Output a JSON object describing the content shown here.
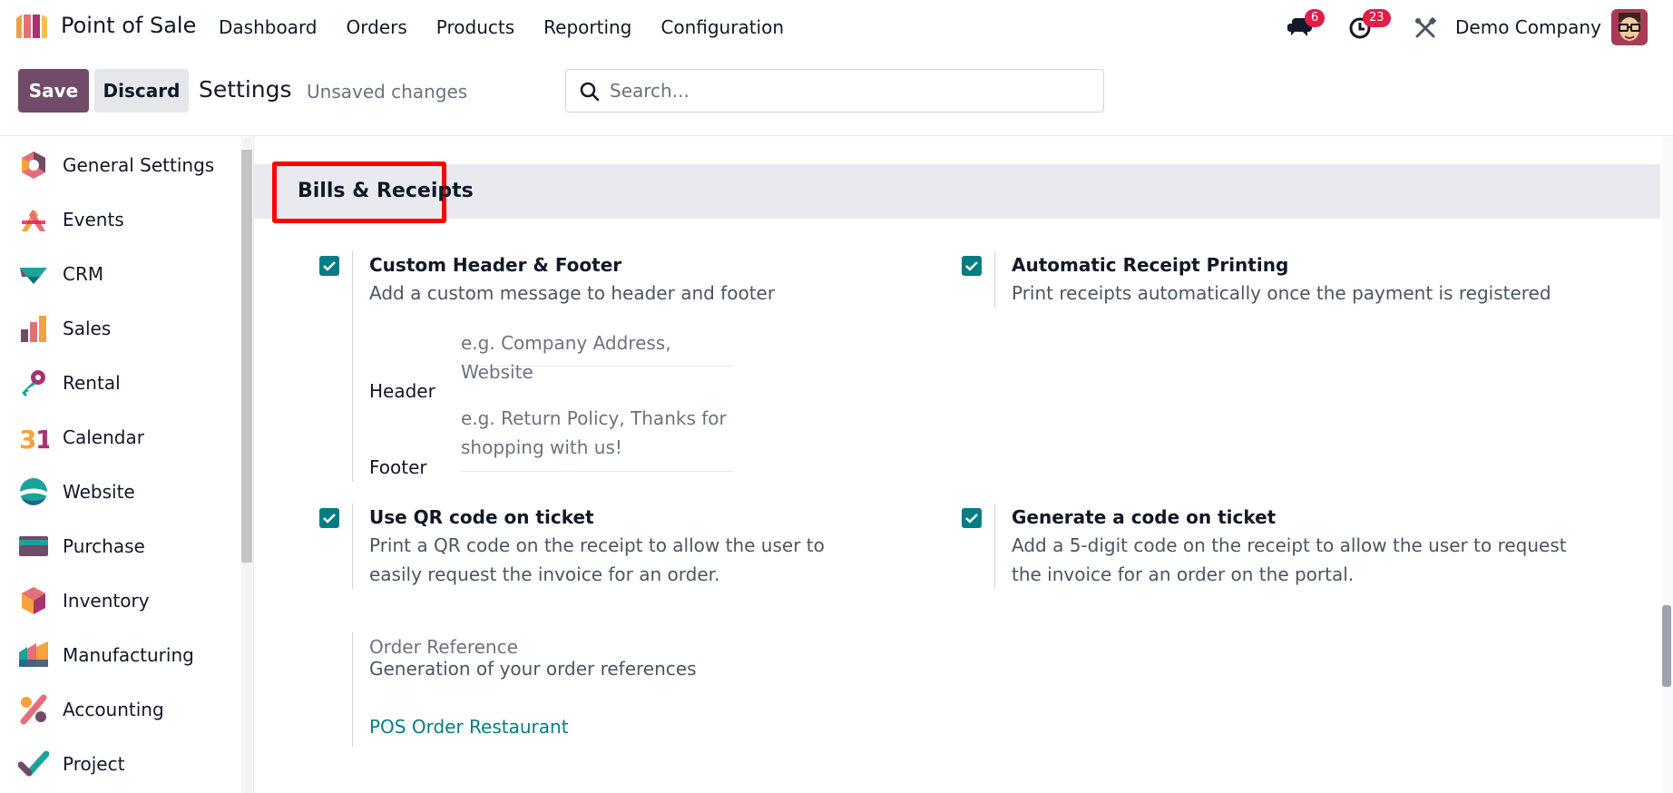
{
  "navbar": {
    "app_name": "Point of Sale",
    "menu": [
      "Dashboard",
      "Orders",
      "Products",
      "Reporting",
      "Configuration"
    ],
    "messages_count": "6",
    "activities_count": "23",
    "company": "Demo Company"
  },
  "control_panel": {
    "save_label": "Save",
    "discard_label": "Discard",
    "title": "Settings",
    "status": "Unsaved changes",
    "search_placeholder": "Search..."
  },
  "sidebar": {
    "items": [
      {
        "label": "General Settings",
        "icon": "general-settings-icon"
      },
      {
        "label": "Events",
        "icon": "events-icon"
      },
      {
        "label": "CRM",
        "icon": "crm-icon"
      },
      {
        "label": "Sales",
        "icon": "sales-icon"
      },
      {
        "label": "Rental",
        "icon": "rental-icon"
      },
      {
        "label": "Calendar",
        "icon": "calendar-icon"
      },
      {
        "label": "Website",
        "icon": "website-icon"
      },
      {
        "label": "Purchase",
        "icon": "purchase-icon"
      },
      {
        "label": "Inventory",
        "icon": "inventory-icon"
      },
      {
        "label": "Manufacturing",
        "icon": "manufacturing-icon"
      },
      {
        "label": "Accounting",
        "icon": "accounting-icon"
      },
      {
        "label": "Project",
        "icon": "project-icon"
      }
    ]
  },
  "section": {
    "title": "Bills & Receipts",
    "custom_header_footer": {
      "title": "Custom Header & Footer",
      "desc": "Add a custom message to header and footer",
      "checked": true,
      "header_label": "Header",
      "header_placeholder": "e.g. Company Address, Website",
      "footer_label": "Footer",
      "footer_placeholder": "e.g. Return Policy, Thanks for shopping with us!"
    },
    "auto_receipt": {
      "title": "Automatic Receipt Printing",
      "desc": "Print receipts automatically once the payment is registered",
      "checked": true
    },
    "qr_code": {
      "title": "Use QR code on ticket",
      "desc": "Print a QR code on the receipt to allow the user to easily request the invoice for an order.",
      "checked": true
    },
    "generate_code": {
      "title": "Generate a code on ticket",
      "desc": "Add a 5-digit code on the receipt to allow the user to request the invoice for an order on the portal.",
      "checked": true
    },
    "order_reference": {
      "label": "Order Reference",
      "desc": "Generation of your order references",
      "link": "POS Order Restaurant"
    }
  },
  "colors": {
    "brand": "#714b67",
    "accent": "#017e84",
    "badge": "#e11d48",
    "highlight": "#ff0000"
  }
}
